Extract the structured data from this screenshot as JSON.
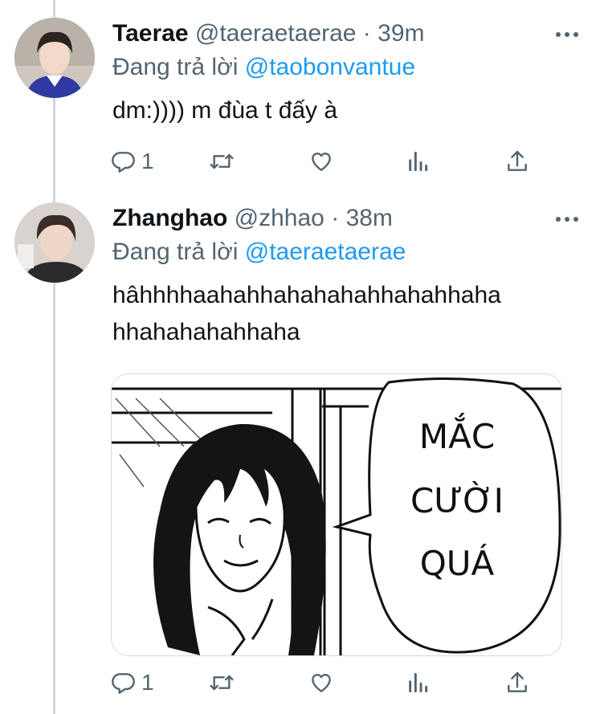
{
  "tweets": [
    {
      "name": "Taerae",
      "handle": "@taeraetaerae",
      "separator": "·",
      "time": "39m",
      "replying_prefix": "Đang trả lời",
      "replying_to": "@taobonvantue",
      "text": "dm:)))) m đùa t đấy à",
      "reply_count": "1"
    },
    {
      "name": "Zhanghao",
      "handle": "@zhhao",
      "separator": "·",
      "time": "38m",
      "replying_prefix": "Đang trả lời",
      "replying_to": "@taeraetaerae",
      "text_line1": "hâhhhhaahahhahahahahhahahhaha",
      "text_line2": "hhahahahahhaha",
      "media": {
        "speech_line1": "MẮC",
        "speech_line2": "CƯỜI",
        "speech_line3": "QUÁ"
      },
      "reply_count": "1"
    }
  ],
  "icons": [
    "reply-icon",
    "retweet-icon",
    "like-icon",
    "analytics-icon",
    "share-icon",
    "more-icon"
  ],
  "colors": {
    "text": "#0f1419",
    "secondary": "#536471",
    "link": "#1d9bf0",
    "thread_line": "#cfd9de"
  }
}
